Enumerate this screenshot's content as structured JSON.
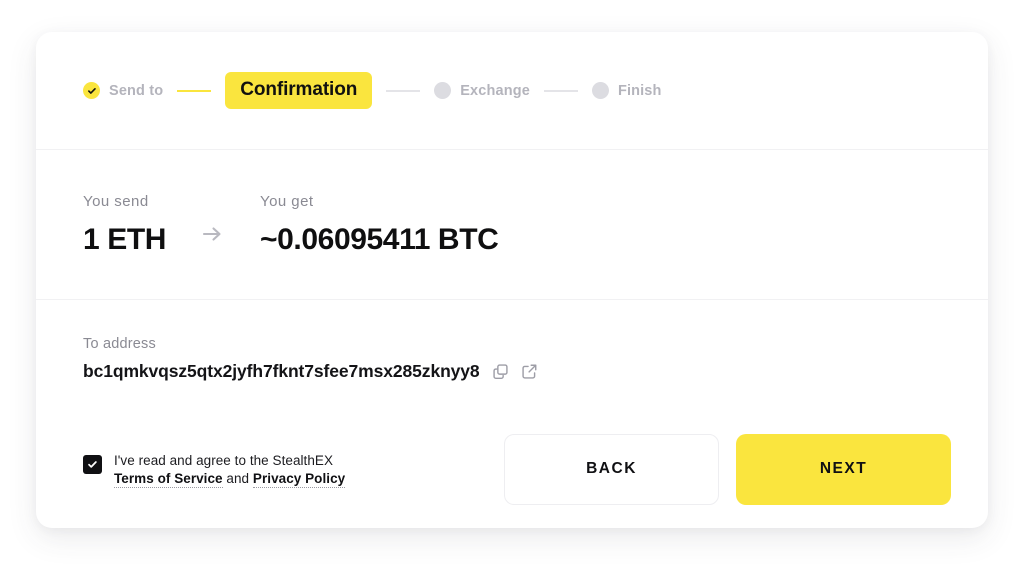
{
  "theme": {
    "accent": "#FAE53E",
    "text_dark": "#101013",
    "text_muted": "#8A8A93",
    "step_inactive": "#DCDCE1",
    "divider": "#F1F1F3",
    "card_bg": "#FFFFFF",
    "page_bg": "#FFFFFF"
  },
  "stepper": {
    "steps": [
      {
        "label": "Send to",
        "state": "done",
        "icon": "check-icon"
      },
      {
        "label": "Confirmation",
        "state": "active"
      },
      {
        "label": "Exchange",
        "state": "pending"
      },
      {
        "label": "Finish",
        "state": "pending"
      }
    ]
  },
  "amounts": {
    "send_caption": "You send",
    "send_value": "1 ETH",
    "arrow_icon": "arrow-right-icon",
    "get_caption": "You get",
    "get_value": "~0.06095411 BTC"
  },
  "address": {
    "caption": "To address",
    "value": "bc1qmkvqsz5qtx2jyfh7fknt7sfee7msx285zknyy8",
    "copy_icon": "copy-icon",
    "external_icon": "external-link-icon"
  },
  "terms": {
    "checked": true,
    "checkbox_icon": "check-icon",
    "lead_text": "I've read and agree to the StealthEX",
    "terms_link": "Terms of Service",
    "conjunction": "and",
    "privacy_link": "Privacy Policy"
  },
  "actions": {
    "back_label": "BACK",
    "next_label": "NEXT"
  }
}
